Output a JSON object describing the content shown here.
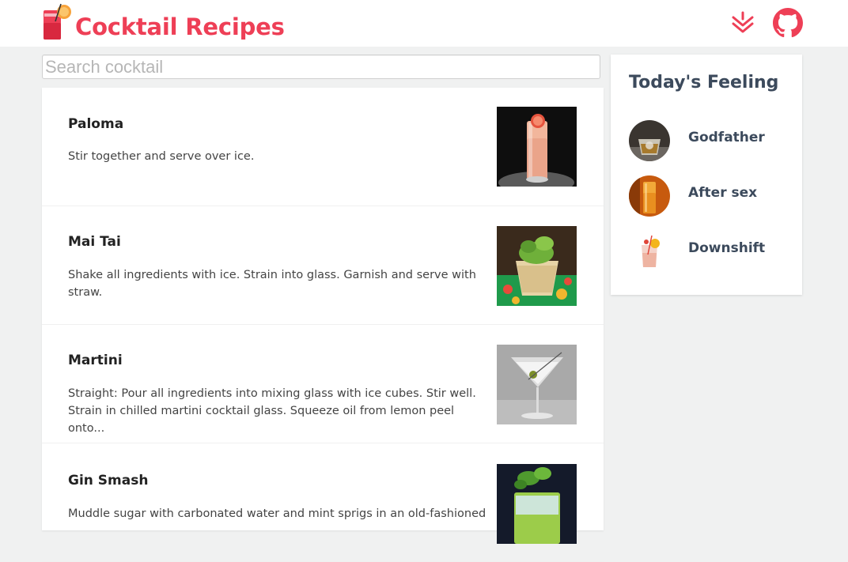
{
  "header": {
    "title": "Cocktail Recipes",
    "accent_color": "#ee3f56",
    "icons": [
      "cocktail-logo-icon",
      "scroll-down-chevrons-icon",
      "github-icon"
    ]
  },
  "search": {
    "placeholder": "Search cocktail",
    "value": ""
  },
  "recipes": [
    {
      "name": "Paloma",
      "description": "Stir together and serve over ice."
    },
    {
      "name": "Mai Tai",
      "description": "Shake all ingredients with ice. Strain into glass. Garnish and serve with straw."
    },
    {
      "name": "Martini",
      "description": "Straight: Pour all ingredients into mixing glass with ice cubes. Stir well. Strain in chilled martini cocktail glass. Squeeze oil from lemon peel onto..."
    },
    {
      "name": "Gin Smash",
      "description": "Muddle sugar with carbonated water and mint sprigs in an old-fashioned"
    }
  ],
  "sidebar": {
    "title": "Today's Feeling",
    "items": [
      {
        "name": "Godfather"
      },
      {
        "name": "After sex"
      },
      {
        "name": "Downshift"
      }
    ]
  }
}
